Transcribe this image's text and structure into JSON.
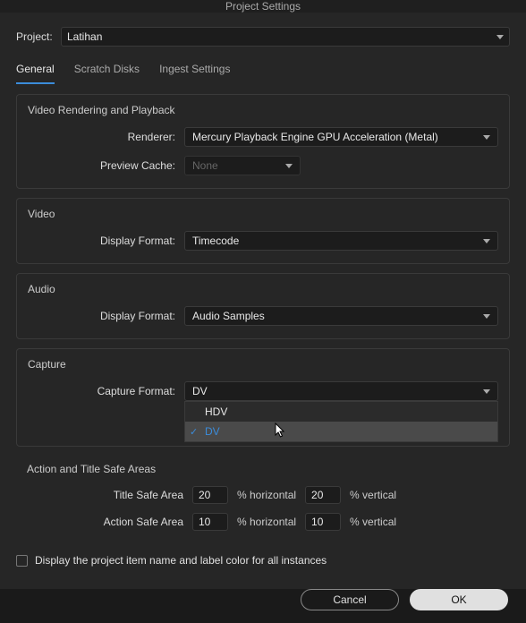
{
  "title": "Project Settings",
  "project_label": "Project:",
  "project_value": "Latihan",
  "tabs": {
    "general": "General",
    "scratch": "Scratch Disks",
    "ingest": "Ingest Settings"
  },
  "rendering": {
    "section": "Video Rendering and Playback",
    "renderer_label": "Renderer:",
    "renderer_value": "Mercury Playback Engine GPU Acceleration (Metal)",
    "preview_label": "Preview Cache:",
    "preview_value": "None"
  },
  "video": {
    "section": "Video",
    "display_label": "Display Format:",
    "display_value": "Timecode"
  },
  "audio": {
    "section": "Audio",
    "display_label": "Display Format:",
    "display_value": "Audio Samples"
  },
  "capture": {
    "section": "Capture",
    "format_label": "Capture Format:",
    "format_value": "DV",
    "options": {
      "hdv": "HDV",
      "dv": "DV"
    }
  },
  "safe": {
    "section": "Action and Title Safe Areas",
    "title_label": "Title Safe Area",
    "action_label": "Action Safe Area",
    "title_h": "20",
    "title_v": "20",
    "action_h": "10",
    "action_v": "10",
    "pct_h": "% horizontal",
    "pct_v": "% vertical"
  },
  "display_checkbox": "Display the project item name and label color for all instances",
  "buttons": {
    "cancel": "Cancel",
    "ok": "OK"
  }
}
